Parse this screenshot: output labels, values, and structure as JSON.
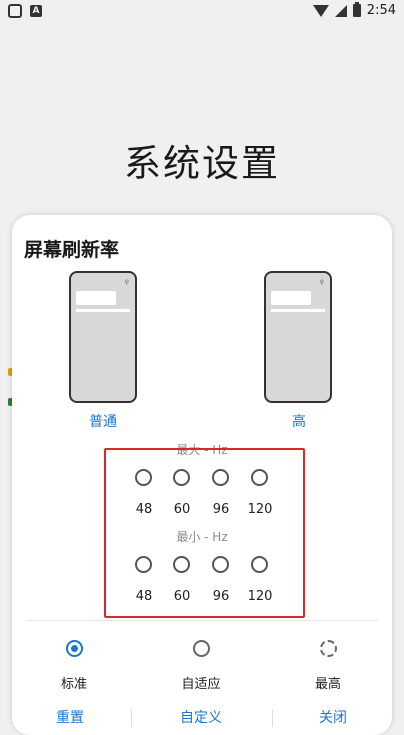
{
  "status_bar": {
    "time": "2:54"
  },
  "page": {
    "title": "系统设置"
  },
  "dialog": {
    "title": "屏幕刷新率",
    "phones": [
      {
        "label": "普通"
      },
      {
        "label": "高"
      }
    ],
    "max_label": "最大 - Hz",
    "min_label": "最小 - Hz",
    "hz_options": [
      "48",
      "60",
      "96",
      "120"
    ],
    "modes": [
      {
        "label": "标准",
        "state": "selected"
      },
      {
        "label": "自适应",
        "state": "unselected"
      },
      {
        "label": "最高",
        "state": "loading"
      }
    ],
    "buttons": {
      "reset": "重置",
      "custom": "自定义",
      "close": "关闭"
    }
  },
  "colors": {
    "accent": "#1976d2",
    "highlight_frame": "#d62a2a"
  }
}
